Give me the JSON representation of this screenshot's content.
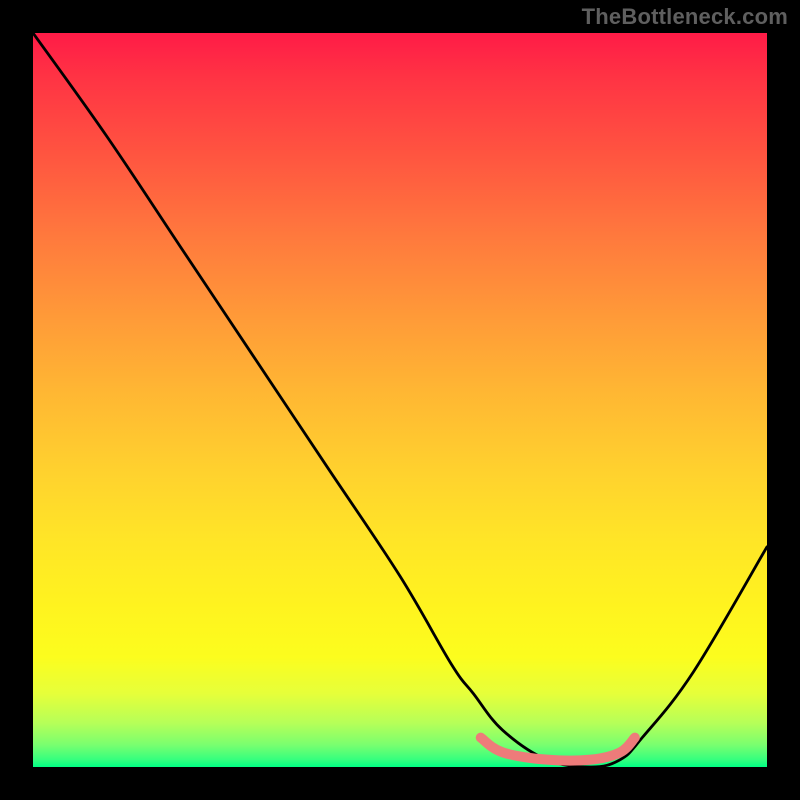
{
  "watermark": "TheBottleneck.com",
  "chart_data": {
    "type": "line",
    "title": "",
    "xlabel": "",
    "ylabel": "",
    "xlim": [
      0,
      100
    ],
    "ylim": [
      0,
      100
    ],
    "series": [
      {
        "name": "bottleneck-curve",
        "x": [
          0,
          10,
          20,
          30,
          40,
          50,
          57,
          60,
          64,
          70,
          76,
          80,
          83,
          90,
          100
        ],
        "values": [
          100,
          86,
          71,
          56,
          41,
          26,
          14,
          10,
          5,
          1,
          0,
          1,
          4,
          13,
          30
        ]
      },
      {
        "name": "highlight-band",
        "x": [
          61,
          64,
          70,
          76,
          80,
          82
        ],
        "values": [
          4,
          2,
          1,
          1,
          2,
          4
        ]
      }
    ],
    "highlight_color": "#ee7b7a",
    "curve_color": "#000000",
    "gradient": {
      "top": "#ff1b47",
      "bottom": "#00ff84"
    }
  }
}
